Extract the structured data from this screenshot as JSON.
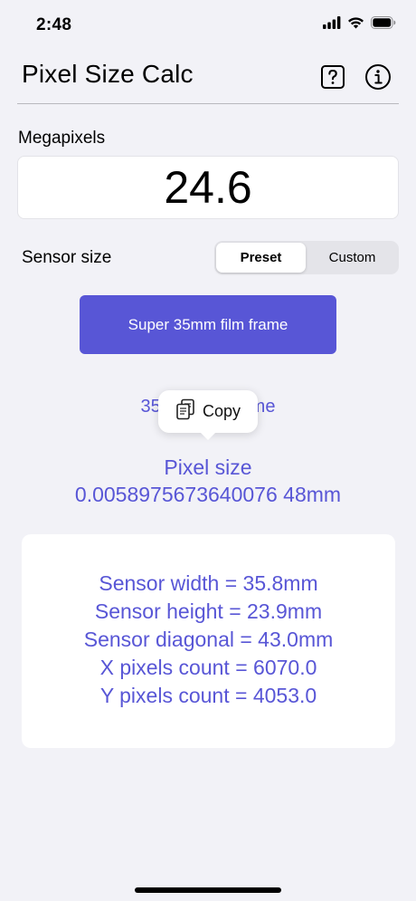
{
  "status_bar": {
    "time": "2:48"
  },
  "nav": {
    "title": "Pixel Size Calc",
    "help_icon": "question-mark-square-icon",
    "info_icon": "info-circle-icon"
  },
  "megapixels": {
    "label": "Megapixels",
    "value": "24.6"
  },
  "sensor": {
    "label": "Sensor size",
    "segments": [
      "Preset",
      "Custom"
    ],
    "selected_segment": "Preset",
    "preset_button_label": "Super 35mm film frame",
    "selected_name": "35mm film frame"
  },
  "context_menu": {
    "copy_label": "Copy",
    "copy_icon": "copy-documents-icon"
  },
  "pixel_size": {
    "title": "Pixel size",
    "value": "0.0058975673640076 48mm"
  },
  "results": [
    "Sensor width = 35.8mm",
    "Sensor height = 23.9mm",
    "Sensor diagonal = 43.0mm",
    "X pixels count = 6070.0",
    "Y pixels count = 4053.0"
  ],
  "colors": {
    "accent": "#5856d6",
    "background": "#f2f2f7"
  }
}
